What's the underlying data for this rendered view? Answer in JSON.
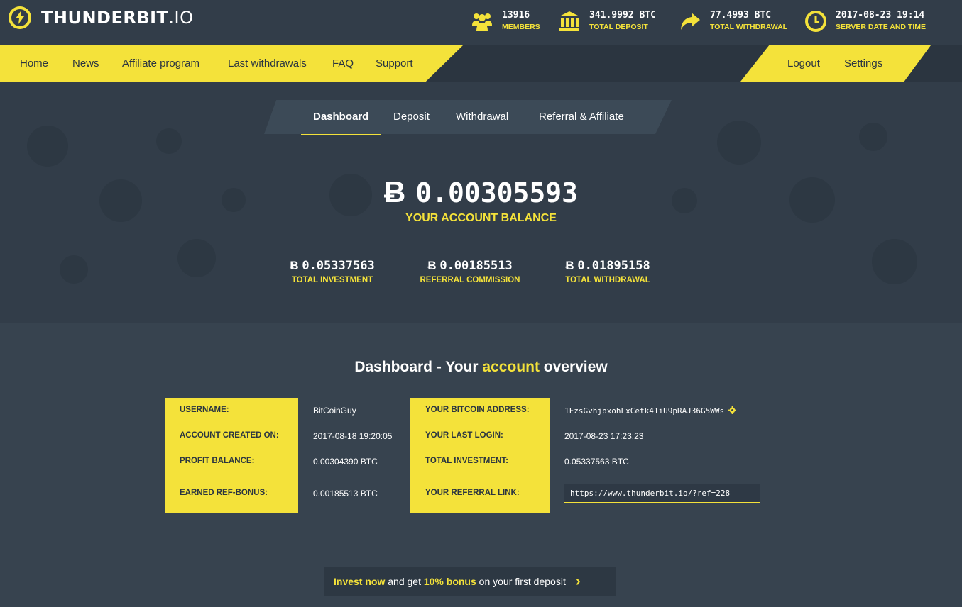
{
  "brand": {
    "name_bold": "THUNDERBIT",
    "name_light": ".IO"
  },
  "stats": [
    {
      "icon": "members-icon",
      "value": "13916",
      "label": "MEMBERS"
    },
    {
      "icon": "bank-icon",
      "value": "341.9992 BTC",
      "label": "TOTAL DEPOSIT"
    },
    {
      "icon": "arrow-share-icon",
      "value": "77.4993 BTC",
      "label": "TOTAL WITHDRAWAL"
    },
    {
      "icon": "clock-icon",
      "value": "2017-08-23 19:14",
      "label": "SERVER DATE AND TIME"
    }
  ],
  "nav": {
    "left": [
      "Home",
      "News",
      "Affiliate program",
      "Last withdrawals",
      "FAQ",
      "Support"
    ],
    "right": [
      "Logout",
      "Settings"
    ]
  },
  "tabs": [
    "Dashboard",
    "Deposit",
    "Withdrawal",
    "Referral & Affiliate"
  ],
  "balance": {
    "symbol": "Ƀ",
    "value": "0.00305593",
    "label": "YOUR ACCOUNT BALANCE"
  },
  "substats": [
    {
      "value": "0.05337563",
      "label": "TOTAL INVESTMENT"
    },
    {
      "value": "0.00185513",
      "label": "REFERRAL COMMISSION"
    },
    {
      "value": "0.01895158",
      "label": "TOTAL WITHDRAWAL"
    }
  ],
  "overview": {
    "title_pre": "Dashboard - Your ",
    "title_accent": "account",
    "title_post": " overview"
  },
  "account_left": [
    {
      "label": "USERNAME:",
      "value": "BitCoinGuy"
    },
    {
      "label": "ACCOUNT CREATED ON:",
      "value": "2017-08-18 19:20:05"
    },
    {
      "label": "PROFIT BALANCE:",
      "value": "0.00304390 BTC"
    },
    {
      "label": "EARNED REF-BONUS:",
      "value": "0.00185513 BTC"
    }
  ],
  "account_right": [
    {
      "label": "YOUR BITCOIN ADDRESS:",
      "value": "1FzsGvhjpxohLxCetk41iU9pRAJ36G5WWs"
    },
    {
      "label": "YOUR LAST LOGIN:",
      "value": "2017-08-23 17:23:23"
    },
    {
      "label": "TOTAL INVESTMENT:",
      "value": "0.05337563 BTC"
    },
    {
      "label": "YOUR REFERRAL LINK:",
      "value": "https://www.thunderbit.io/?ref=228"
    }
  ],
  "cta": {
    "part1": "Invest now",
    "part2": " and get ",
    "part3": "10% bonus",
    "part4": " on your first deposit",
    "arrow": "›"
  },
  "colors": {
    "accent": "#f4e23a",
    "background": "#37434f",
    "header": "#323d49"
  }
}
